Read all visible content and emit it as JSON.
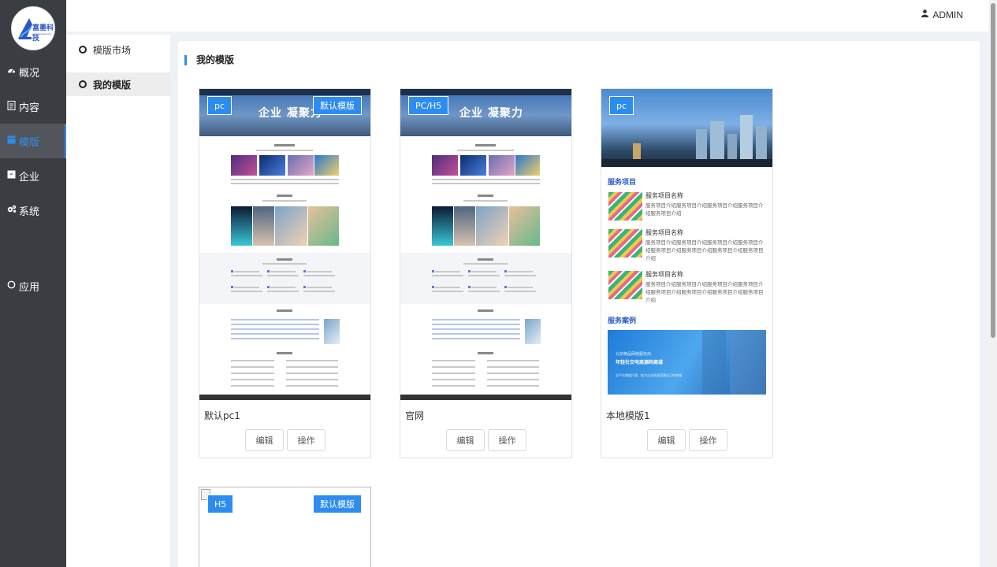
{
  "brand": {
    "logo_text": "富墨科技",
    "logo_sub": "www.fumokeji.com"
  },
  "header": {
    "user_label": "ADMIN"
  },
  "sidebar": {
    "items": [
      {
        "label": "概况",
        "icon": "dashboard-icon"
      },
      {
        "label": "内容",
        "icon": "document-icon"
      },
      {
        "label": "模版",
        "icon": "template-icon",
        "active": true
      },
      {
        "label": "企业",
        "icon": "building-icon"
      },
      {
        "label": "系统",
        "icon": "gears-icon"
      },
      {
        "label": "应用",
        "icon": "circle-icon"
      }
    ]
  },
  "submenu": {
    "items": [
      {
        "label": "模版市场"
      },
      {
        "label": "我的模版",
        "active": true
      }
    ]
  },
  "main": {
    "title": "我的模版",
    "cards": [
      {
        "name": "默认pc1",
        "tag": "pc",
        "default_tag": "默认模版",
        "edit_label": "编辑",
        "ops_label": "操作",
        "hero_text": "企业 凝聚力"
      },
      {
        "name": "官网",
        "tag": "PC/H5",
        "edit_label": "编辑",
        "ops_label": "操作",
        "hero_text": "企业 凝聚力"
      },
      {
        "name": "本地模版1",
        "tag": "pc",
        "edit_label": "编辑",
        "ops_label": "操作",
        "services_heading": "服务项目",
        "service_items": [
          {
            "title": "服务项目名称",
            "desc": "服务项目介绍服务项目介绍服务项目介绍服务项目介绍服务项目介绍"
          },
          {
            "title": "服务项目名称",
            "desc": "服务项目介绍服务项目介绍服务项目介绍服务项目介绍服务项目介绍服务项目介绍服务项目介绍服务项目介绍"
          },
          {
            "title": "服务项目名称",
            "desc": "服务项目介绍服务项目介绍服务项目介绍服务项目介绍服务项目介绍服务项目介绍服务项目介绍服务项目介绍"
          }
        ],
        "cases_heading": "服务案例",
        "case_line1": "北京精品网络服务商",
        "case_line2": "年轻社交电商源码商城",
        "case_line3": "全平台数据打通，助力企业快速搭建自己的商城"
      },
      {
        "name": "",
        "tag": "H5",
        "default_tag": "默认模版"
      }
    ]
  },
  "colors": {
    "accent": "#2d8cf0",
    "sidebar_bg": "#3a3d42"
  }
}
